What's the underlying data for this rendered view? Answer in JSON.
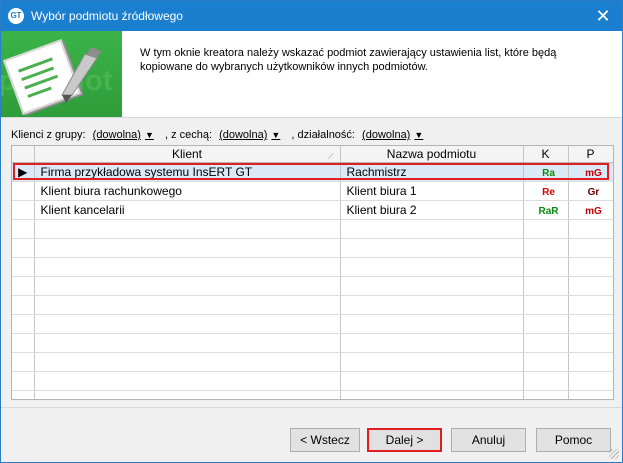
{
  "window": {
    "title": "Wybór podmiotu źródłowego",
    "close_label": "✕",
    "app_icon": "GT"
  },
  "header": {
    "description": "W tym oknie kreatora należy wskazać podmiot zawierający ustawienia list, które będą kopiowane do wybranych użytkowników innych podmiotów.",
    "watermark": "podmiot"
  },
  "filters": {
    "group_label": "Klienci z grupy:",
    "group_value": "(dowolna)",
    "feature_label": ", z cechą:",
    "feature_value": "(dowolna)",
    "activity_label": ", działalność:",
    "activity_value": "(dowolna)",
    "arrow": "▼"
  },
  "table": {
    "columns": [
      "Klient",
      "Nazwa podmiotu",
      "K",
      "P"
    ],
    "rows": [
      {
        "indicator": "▶",
        "client": "Firma przykładowa systemu InsERT GT",
        "entity": "Rachmistrz",
        "k": "Ra",
        "p": "mG"
      },
      {
        "indicator": "",
        "client": "Klient biura rachunkowego",
        "entity": "Klient biura 1",
        "k": "Re",
        "p": "Gr"
      },
      {
        "indicator": "",
        "client": "Klient kancelarii",
        "entity": "Klient biura 2",
        "k": "RaR",
        "p": "mG"
      }
    ],
    "sort_icon": "sort-indicator"
  },
  "buttons": {
    "back": "< Wstecz",
    "next": "Dalej >",
    "cancel": "Anuluj",
    "help": "Pomoc"
  },
  "colors": {
    "titlebar": "#1b7fd0",
    "banner": "#3bb34a",
    "selection_outline": "#e02020"
  }
}
